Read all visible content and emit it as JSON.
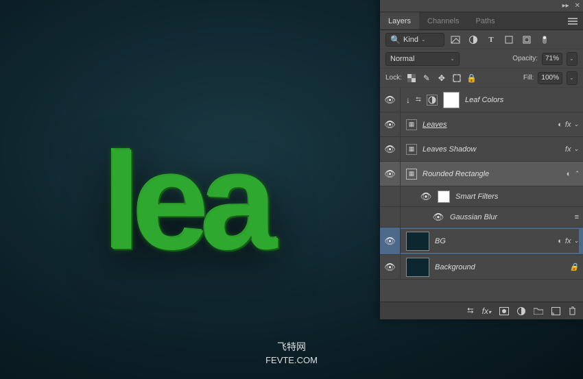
{
  "canvas": {
    "text": "lea",
    "watermark_cn": "飞特网",
    "watermark_en": "FEVTE.COM"
  },
  "panel": {
    "tabs": [
      "Layers",
      "Channels",
      "Paths"
    ],
    "active_tab": 0,
    "filter": {
      "label": "Kind"
    },
    "blend": {
      "mode": "Normal",
      "opacity_label": "Opacity:",
      "opacity_value": "71%"
    },
    "lock": {
      "label": "Lock:",
      "fill_label": "Fill:",
      "fill_value": "100%"
    },
    "layers": [
      {
        "name": "Leaf Colors"
      },
      {
        "name": "Leaves"
      },
      {
        "name": "Leaves Shadow"
      },
      {
        "name": "Rounded Rectangle"
      },
      {
        "name": "Smart Filters"
      },
      {
        "name": "Gaussian Blur"
      },
      {
        "name": "BG"
      },
      {
        "name": "Background"
      }
    ],
    "fx_label": "fx"
  }
}
